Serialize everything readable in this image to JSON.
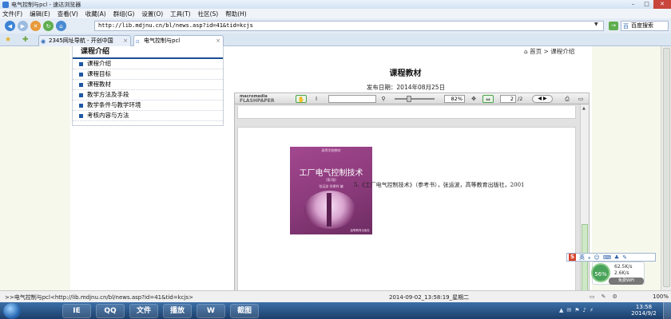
{
  "window": {
    "title": "电气控制与pcl - 速达浏览器"
  },
  "menu": [
    "文件(F)",
    "编辑(E)",
    "查看(V)",
    "收藏(A)",
    "群组(G)",
    "设置(O)",
    "工具(T)",
    "社区(S)",
    "帮助(H)"
  ],
  "address": {
    "url": "http://lib.mdjnu.cn/bl/news.asp?id=41&tid=kcjs",
    "search_placeholder": "百度搜索"
  },
  "tabs": [
    {
      "label": "2345网址导航 - 开创中国",
      "active": false
    },
    {
      "label": "电气控制与pcl",
      "active": true
    }
  ],
  "sidebar": {
    "title": "课程介绍",
    "items": [
      "课程介绍",
      "课程目标",
      "课程教材",
      "教学方法及手段",
      "教学条件与教学环境",
      "考核内容与方法"
    ]
  },
  "breadcrumb": {
    "home": "首页",
    "sep": ">",
    "current": "课程介绍"
  },
  "article": {
    "title": "课程教材",
    "date": "发布日期：2014年08月25日"
  },
  "viewer": {
    "logo_top": "macromedia",
    "logo_bottom": "FLASHPAPER",
    "zoom": "82%",
    "page": "2",
    "page_total": "/2"
  },
  "book": {
    "series": "高等学校教材",
    "title": "工厂电气控制技术",
    "edition": "（第2版）",
    "author": "张运波 徐建祥 编",
    "publisher": "高等教育出版社"
  },
  "reference": "5.《工厂电气控制技术》（参考书），张运波，高等教育出版社，2001",
  "ime": {
    "label": "英"
  },
  "net": {
    "percent": "56%",
    "up": "62.5K/s",
    "down": "2.6K/s",
    "wifi": "免费WiFi"
  },
  "status": {
    "link": ">>电气控制与pcl<http://lib.mdjnu.cn/bl/news.asp?id=41&tid=kcjs>",
    "datetime": "2014-09-02_13:58:19_星期二",
    "zoom": "100%"
  },
  "clock": {
    "time": "13:58",
    "date": "2014/9/2"
  },
  "taskbar": [
    "IE",
    "QQ",
    "文件",
    "播放",
    "W",
    "截图"
  ]
}
